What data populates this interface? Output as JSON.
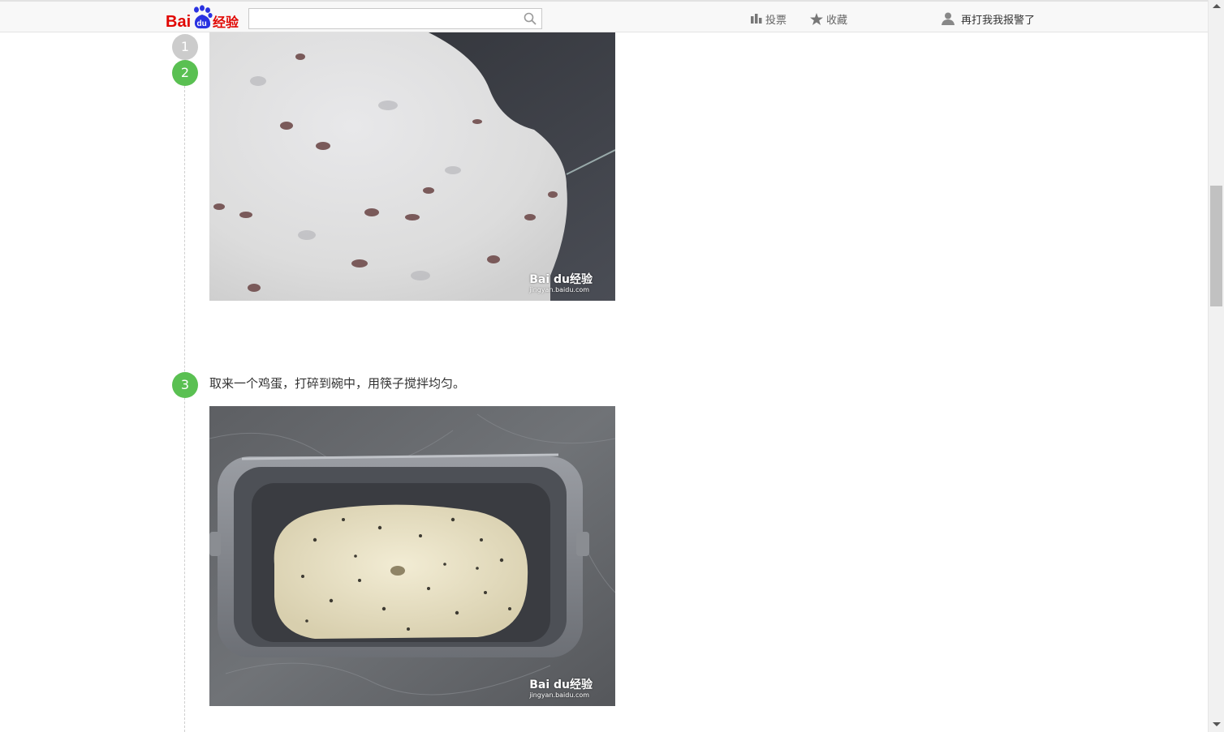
{
  "header": {
    "logo_text_bai": "Bai",
    "logo_text_du": "du",
    "logo_text_jingyan": "经验",
    "search": {
      "value": "",
      "placeholder": ""
    },
    "nav": {
      "vote_label": "投票",
      "favorite_label": "收藏",
      "user_label": "再打我我报警了"
    }
  },
  "steps": [
    {
      "number": "1"
    },
    {
      "number": "2",
      "image_watermark_logo": "Bai du经验",
      "image_watermark_url": "jingyan.baidu.com"
    },
    {
      "number": "3",
      "text": "取来一个鸡蛋，打碎到碗中，用筷子搅拌均匀。",
      "image_watermark_logo": "Bai du经验",
      "image_watermark_url": "jingyan.baidu.com"
    }
  ],
  "colors": {
    "step_active": "#5ac052",
    "step_inactive": "#cccccc",
    "baidu_red": "#e10602",
    "baidu_blue": "#2932e1"
  },
  "icons": [
    "search-icon",
    "bar-chart-icon",
    "star-icon",
    "user-icon"
  ]
}
